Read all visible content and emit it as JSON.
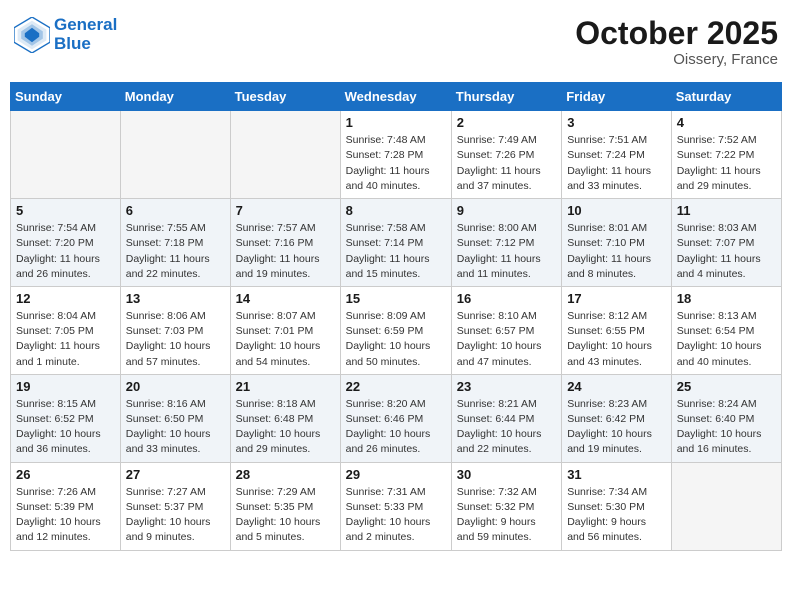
{
  "header": {
    "logo_line1": "General",
    "logo_line2": "Blue",
    "month": "October 2025",
    "location": "Oissery, France"
  },
  "days_of_week": [
    "Sunday",
    "Monday",
    "Tuesday",
    "Wednesday",
    "Thursday",
    "Friday",
    "Saturday"
  ],
  "weeks": [
    {
      "shaded": false,
      "days": [
        {
          "num": "",
          "info": ""
        },
        {
          "num": "",
          "info": ""
        },
        {
          "num": "",
          "info": ""
        },
        {
          "num": "1",
          "info": "Sunrise: 7:48 AM\nSunset: 7:28 PM\nDaylight: 11 hours\nand 40 minutes."
        },
        {
          "num": "2",
          "info": "Sunrise: 7:49 AM\nSunset: 7:26 PM\nDaylight: 11 hours\nand 37 minutes."
        },
        {
          "num": "3",
          "info": "Sunrise: 7:51 AM\nSunset: 7:24 PM\nDaylight: 11 hours\nand 33 minutes."
        },
        {
          "num": "4",
          "info": "Sunrise: 7:52 AM\nSunset: 7:22 PM\nDaylight: 11 hours\nand 29 minutes."
        }
      ]
    },
    {
      "shaded": true,
      "days": [
        {
          "num": "5",
          "info": "Sunrise: 7:54 AM\nSunset: 7:20 PM\nDaylight: 11 hours\nand 26 minutes."
        },
        {
          "num": "6",
          "info": "Sunrise: 7:55 AM\nSunset: 7:18 PM\nDaylight: 11 hours\nand 22 minutes."
        },
        {
          "num": "7",
          "info": "Sunrise: 7:57 AM\nSunset: 7:16 PM\nDaylight: 11 hours\nand 19 minutes."
        },
        {
          "num": "8",
          "info": "Sunrise: 7:58 AM\nSunset: 7:14 PM\nDaylight: 11 hours\nand 15 minutes."
        },
        {
          "num": "9",
          "info": "Sunrise: 8:00 AM\nSunset: 7:12 PM\nDaylight: 11 hours\nand 11 minutes."
        },
        {
          "num": "10",
          "info": "Sunrise: 8:01 AM\nSunset: 7:10 PM\nDaylight: 11 hours\nand 8 minutes."
        },
        {
          "num": "11",
          "info": "Sunrise: 8:03 AM\nSunset: 7:07 PM\nDaylight: 11 hours\nand 4 minutes."
        }
      ]
    },
    {
      "shaded": false,
      "days": [
        {
          "num": "12",
          "info": "Sunrise: 8:04 AM\nSunset: 7:05 PM\nDaylight: 11 hours\nand 1 minute."
        },
        {
          "num": "13",
          "info": "Sunrise: 8:06 AM\nSunset: 7:03 PM\nDaylight: 10 hours\nand 57 minutes."
        },
        {
          "num": "14",
          "info": "Sunrise: 8:07 AM\nSunset: 7:01 PM\nDaylight: 10 hours\nand 54 minutes."
        },
        {
          "num": "15",
          "info": "Sunrise: 8:09 AM\nSunset: 6:59 PM\nDaylight: 10 hours\nand 50 minutes."
        },
        {
          "num": "16",
          "info": "Sunrise: 8:10 AM\nSunset: 6:57 PM\nDaylight: 10 hours\nand 47 minutes."
        },
        {
          "num": "17",
          "info": "Sunrise: 8:12 AM\nSunset: 6:55 PM\nDaylight: 10 hours\nand 43 minutes."
        },
        {
          "num": "18",
          "info": "Sunrise: 8:13 AM\nSunset: 6:54 PM\nDaylight: 10 hours\nand 40 minutes."
        }
      ]
    },
    {
      "shaded": true,
      "days": [
        {
          "num": "19",
          "info": "Sunrise: 8:15 AM\nSunset: 6:52 PM\nDaylight: 10 hours\nand 36 minutes."
        },
        {
          "num": "20",
          "info": "Sunrise: 8:16 AM\nSunset: 6:50 PM\nDaylight: 10 hours\nand 33 minutes."
        },
        {
          "num": "21",
          "info": "Sunrise: 8:18 AM\nSunset: 6:48 PM\nDaylight: 10 hours\nand 29 minutes."
        },
        {
          "num": "22",
          "info": "Sunrise: 8:20 AM\nSunset: 6:46 PM\nDaylight: 10 hours\nand 26 minutes."
        },
        {
          "num": "23",
          "info": "Sunrise: 8:21 AM\nSunset: 6:44 PM\nDaylight: 10 hours\nand 22 minutes."
        },
        {
          "num": "24",
          "info": "Sunrise: 8:23 AM\nSunset: 6:42 PM\nDaylight: 10 hours\nand 19 minutes."
        },
        {
          "num": "25",
          "info": "Sunrise: 8:24 AM\nSunset: 6:40 PM\nDaylight: 10 hours\nand 16 minutes."
        }
      ]
    },
    {
      "shaded": false,
      "days": [
        {
          "num": "26",
          "info": "Sunrise: 7:26 AM\nSunset: 5:39 PM\nDaylight: 10 hours\nand 12 minutes."
        },
        {
          "num": "27",
          "info": "Sunrise: 7:27 AM\nSunset: 5:37 PM\nDaylight: 10 hours\nand 9 minutes."
        },
        {
          "num": "28",
          "info": "Sunrise: 7:29 AM\nSunset: 5:35 PM\nDaylight: 10 hours\nand 5 minutes."
        },
        {
          "num": "29",
          "info": "Sunrise: 7:31 AM\nSunset: 5:33 PM\nDaylight: 10 hours\nand 2 minutes."
        },
        {
          "num": "30",
          "info": "Sunrise: 7:32 AM\nSunset: 5:32 PM\nDaylight: 9 hours\nand 59 minutes."
        },
        {
          "num": "31",
          "info": "Sunrise: 7:34 AM\nSunset: 5:30 PM\nDaylight: 9 hours\nand 56 minutes."
        },
        {
          "num": "",
          "info": ""
        }
      ]
    }
  ]
}
